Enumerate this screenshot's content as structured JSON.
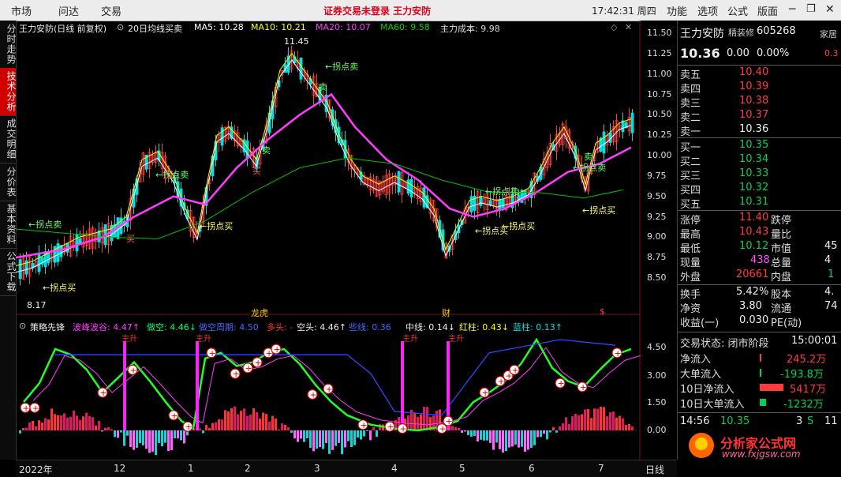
{
  "menu": {
    "items": [
      "市场",
      "问达",
      "交易"
    ],
    "warning": "证券交易未登录 王力安防",
    "clock": "17:42:31 周四",
    "right_items": [
      "功能",
      "选项",
      "公式",
      "版面"
    ]
  },
  "left_tabs": [
    "分时走势",
    "技术分析",
    "成交明细",
    "分价表",
    "基本资料",
    "公式下载"
  ],
  "chart": {
    "title": "王力安防(日线 前复权)",
    "indicator": "20日均线买卖",
    "ma": {
      "ma5": "MA5: 10.28",
      "ma10": "MA10: 10.21",
      "ma20": "MA20: 10.07",
      "ma60": "MA60: 9.58",
      "cost": "主力成本: 9.98"
    },
    "price_axis": [
      "11.50",
      "11.25",
      "11.00",
      "10.75",
      "10.50",
      "10.25",
      "10.00",
      "9.75",
      "9.50",
      "9.25",
      "9.00",
      "8.75",
      "8.50"
    ],
    "high_label": "11.45",
    "low_label": "8.17",
    "signal_sell": "←拐点卖",
    "signal_buy": "←拐点买",
    "sell": "卖",
    "buy": "买",
    "markers": [
      "龙虎",
      "财"
    ],
    "sub_axis": [
      "4.50",
      "3.00",
      "1.50",
      "0.00"
    ],
    "sub_legend": {
      "name": "策略先锋",
      "bofeng": "波峰波谷: 4.47↑",
      "zuokong": "做空: 4.46↓",
      "zuokong_cycle": "做空周期: 4.50",
      "duotou": "多头: -",
      "kongtou": "空头: 4.46↑",
      "kuanzhu": "些线: 0.36",
      "zhongxian": "中线: 0.14↓",
      "hongzhu": "红柱: 0.43↓",
      "lanzhu": "蓝柱: 0.13↑"
    },
    "sub_top_label": "主升",
    "date_axis": [
      "2022年",
      "12",
      "1",
      "2",
      "3",
      "4",
      "5",
      "6",
      "7"
    ],
    "period": "日线"
  },
  "quote": {
    "name": "王力安防",
    "tag": "精装修",
    "code": "605268",
    "extra": "家居",
    "extra_val": "0.3",
    "price": "10.36",
    "change": "0.00",
    "pct": "0.00%",
    "asks": [
      {
        "label": "卖五",
        "price": "10.40"
      },
      {
        "label": "卖四",
        "price": "10.39"
      },
      {
        "label": "卖三",
        "price": "10.38"
      },
      {
        "label": "卖二",
        "price": "10.37"
      },
      {
        "label": "卖一",
        "price": "10.36"
      }
    ],
    "bids": [
      {
        "label": "买一",
        "price": "10.35"
      },
      {
        "label": "买二",
        "price": "10.34"
      },
      {
        "label": "买三",
        "price": "10.33"
      },
      {
        "label": "买四",
        "price": "10.32"
      },
      {
        "label": "买五",
        "price": "10.31"
      }
    ],
    "stats": [
      {
        "l": "涨停",
        "v": "11.40",
        "l2": "跌停"
      },
      {
        "l": "最高",
        "v": "10.43",
        "l2": "量比"
      },
      {
        "l": "最低",
        "v": "10.12",
        "l2": "市值",
        "v2": "45"
      },
      {
        "l": "现量",
        "v": "438",
        "l2": "总量",
        "v2": "4"
      },
      {
        "l": "外盘",
        "v": "20661",
        "l2": "内盘",
        "v2": "1"
      }
    ],
    "stats2": [
      {
        "l": "换手",
        "v": "5.42%",
        "l2": "股本",
        "v2": "4."
      },
      {
        "l": "净资",
        "v": "3.80",
        "l2": "流通",
        "v2": "74"
      },
      {
        "l": "收益(一)",
        "v": "0.030",
        "l2": "PE(动)"
      }
    ],
    "trade_state": "交易状态: 闭市阶段",
    "trade_time": "15:00:01",
    "flows": [
      {
        "l": "净流入",
        "v": "245.2万"
      },
      {
        "l": "大单流入",
        "v": "-193.8万"
      },
      {
        "l": "10日净流入",
        "v": "5417万"
      },
      {
        "l": "10日大单流入",
        "v": "-1232万"
      }
    ],
    "tick_time": "14:56",
    "tick_price": "10.35",
    "tick_vol": "3",
    "tick_s": "S",
    "tick_n": "11"
  },
  "watermark": {
    "site": "分析家公式网",
    "url": "www.fxjgsw.com"
  },
  "colors": {
    "up": "#ff3c3c",
    "down": "#00e0e0",
    "ma5": "#ffffff",
    "ma10": "#ffff00",
    "ma20": "#ff3cff",
    "ma60": "#00d000"
  }
}
